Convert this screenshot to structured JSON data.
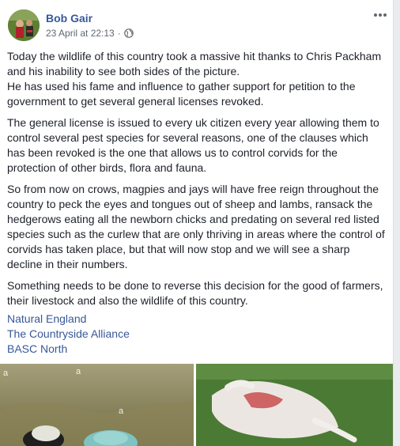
{
  "post": {
    "author": "Bob Gair",
    "timestamp": "23 April at 22:13",
    "separator": "·",
    "privacy_icon": "globe-icon",
    "more_icon": "ellipsis-icon",
    "paragraphs": [
      "Today the wildlife of this country took a massive hit thanks to Chris Packham and his inability to see both sides of the picture. He has used his fame and influence to gather support for petition to the government to get several general licenses revoked.",
      "The general license is issued to every uk citizen every year allowing them to control several pest species for several reasons, one of the clauses which has been revoked is the one that allows us to control corvids for the protection of other birds, flora and fauna.",
      "So from now on crows, magpies and jays will have free reign throughout the country to peck the eyes and tongues out of sheep and lambs, ransack the hedgerows eating all the newborn chicks and predating on several red listed species such as the curlew that are only thriving in areas where the control of corvids has taken place, but that will now stop and we will see a sharp decline in their numbers.",
      "Something needs to be done to reverse this decision for the good of farmers, their livestock and also the wildlife of this country."
    ],
    "paragraph_1_line_1": "Today the wildlife of this country took a massive hit thanks to Chris Packham and his inability to see both sides of the picture.",
    "paragraph_1_line_2": "He has used his fame and influence to gather support for petition to the government to get several general licenses revoked.",
    "tags": [
      "Natural England",
      "The Countryside Alliance",
      "BASC North"
    ],
    "watermark": "a"
  },
  "colors": {
    "link": "#385898",
    "text": "#1d2129",
    "meta": "#616770"
  }
}
